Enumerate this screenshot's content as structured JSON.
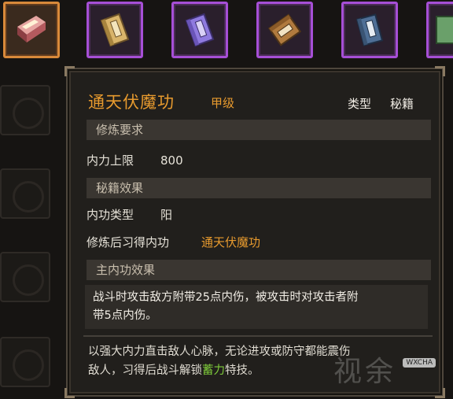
{
  "inventory": {
    "slots": [
      {
        "name": "book-red-icon",
        "rarity": "selected",
        "color": "#c4696c"
      },
      {
        "name": "book-yellow-icon",
        "rarity": "rare",
        "color": "#d9b46a"
      },
      {
        "name": "book-purple-icon",
        "rarity": "rare",
        "color": "#8f7adf"
      },
      {
        "name": "book-brown-icon",
        "rarity": "rare",
        "color": "#b07a3e"
      },
      {
        "name": "book-blue-icon",
        "rarity": "rare",
        "color": "#4f6f96"
      },
      {
        "name": "book-green-icon",
        "rarity": "rare",
        "color": "#6aa06a"
      }
    ]
  },
  "tooltip": {
    "title": "通天伏魔功",
    "grade": "甲级",
    "type_label": "类型",
    "type_value": "秘籍",
    "sections": {
      "requirement_header": "修炼要求",
      "requirement_label": "内力上限",
      "requirement_value": "800",
      "effect_header": "秘籍效果",
      "inner_type_label": "内功类型",
      "inner_type_value": "阳",
      "learn_label": "修炼后习得内功",
      "learn_value": "通天伏魔功",
      "main_effect_header": "主内功效果",
      "main_effect_line1": "战斗时攻击敌方附带25点内伤，被攻击时对攻击者附",
      "main_effect_line2": "带5点内伤。"
    },
    "flavor": {
      "line1": "以强大内力直击敌人心脉，无论进攻或防守都能震伤",
      "line2_a": "敌人，习得后战斗解锁",
      "line2_skill": "蓄力",
      "line2_b": "特技。"
    }
  },
  "watermark": {
    "text": "视余",
    "tag": "WXCHA"
  },
  "colors": {
    "title": "#e79a2e",
    "skill_highlight": "#7ecb3a",
    "selected_border": "#d8893a",
    "rare_border": "#a64fd6"
  }
}
